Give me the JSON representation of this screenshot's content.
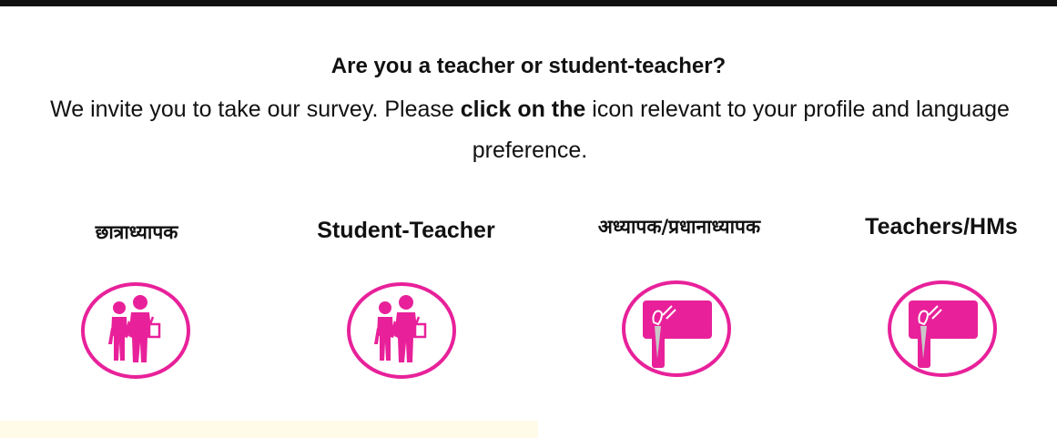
{
  "survey": {
    "heading": "Are you a teacher or student-teacher?",
    "intro_before": "We invite you to take our survey. Please ",
    "intro_bold": "click on the",
    "intro_after": " icon relevant to your profile and language preference."
  },
  "options": [
    {
      "label": "छात्राध्यापक",
      "icon": "student-teacher-icon"
    },
    {
      "label": "Student-Teacher",
      "icon": "student-teacher-icon"
    },
    {
      "label": "अध्यापक/प्रधानाध्यापक",
      "icon": "teacher-board-icon"
    },
    {
      "label": "Teachers/HMs",
      "icon": "teacher-board-icon"
    }
  ],
  "colors": {
    "accent": "#e8219a",
    "text": "#111111",
    "top_rule": "#111111",
    "bottom_panel": "#fffbe8"
  }
}
